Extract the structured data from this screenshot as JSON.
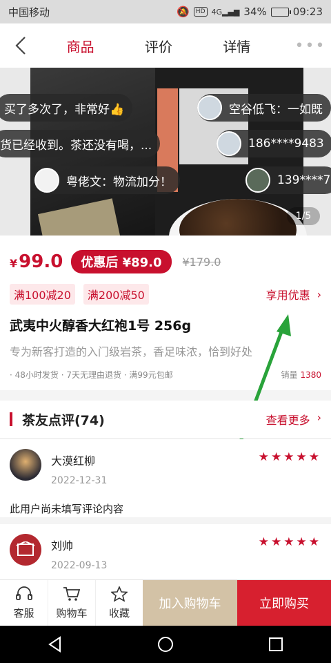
{
  "status_bar": {
    "carrier": "中国移动",
    "network": "4G",
    "hd": "HD",
    "battery": "34%",
    "time": "09:23"
  },
  "nav": {
    "tabs": [
      {
        "label": "商品",
        "active": true
      },
      {
        "label": "评价",
        "active": false
      },
      {
        "label": "详情",
        "active": false
      }
    ]
  },
  "gallery": {
    "pager": "1/5",
    "barrage": [
      {
        "text": "买了多次了，非常好👍"
      },
      {
        "text": "空谷低飞：一如既"
      },
      {
        "text": "货已经收到。茶还没有喝，..."
      },
      {
        "text": "186****9483"
      },
      {
        "text": "粤佬文：物流加分！"
      },
      {
        "text": "139****7"
      }
    ]
  },
  "product": {
    "currency": "¥",
    "price": "99.0",
    "promo_label": "优惠后 ¥89.0",
    "original_price": "¥179.0",
    "coupons": [
      "满100减20",
      "满200减50"
    ],
    "use_coupon": "享用优惠",
    "title": "武夷中火醇香大红袍1号 256g",
    "subtitle": "专为新客打造的入门级岩茶，香足味浓，恰到好处",
    "services": "· 48小时发货 · 7天无理由退货 · 满99元包邮",
    "sales_label": "销量",
    "sales_count": "1380"
  },
  "reviews": {
    "title": "茶友点评(74)",
    "more": "查看更多",
    "items": [
      {
        "name": "大漠红柳",
        "date": "2022-12-31",
        "rating": 5,
        "text": "此用户尚未填写评论内容"
      },
      {
        "name": "刘帅",
        "date": "2022-09-13",
        "rating": 5
      }
    ]
  },
  "bottom_bar": {
    "service": "客服",
    "cart": "购物车",
    "favorite": "收藏",
    "add_to_cart": "加入购物车",
    "buy_now": "立即购买"
  },
  "colors": {
    "accent": "#c8102e",
    "add_cart_bg": "#d3c2a6",
    "buy_now_bg": "#d7202f",
    "annotation_arrow": "#29a33a"
  }
}
